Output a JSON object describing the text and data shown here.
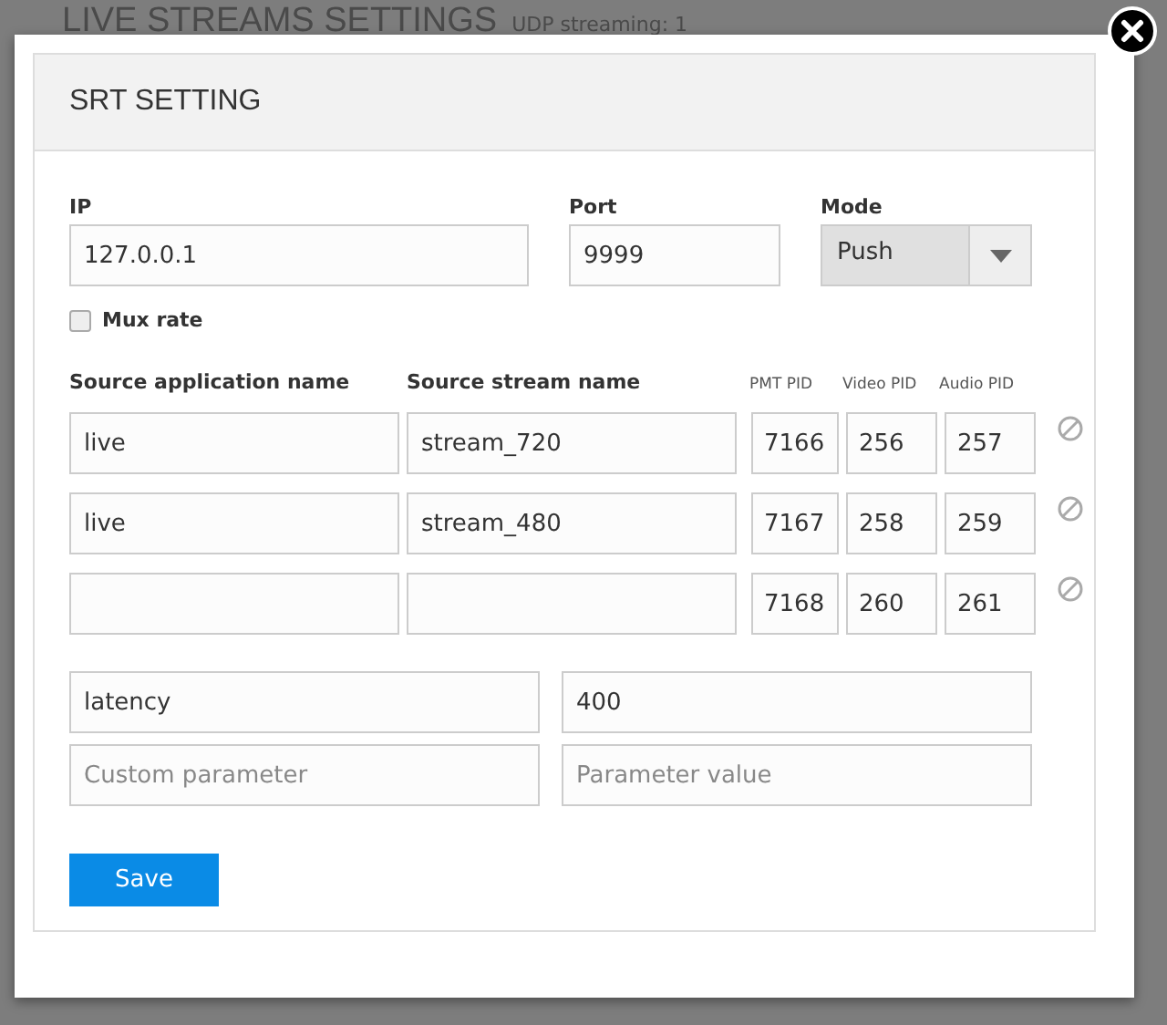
{
  "page": {
    "title": "LIVE STREAMS SETTINGS",
    "subtitle": "UDP streaming: 1"
  },
  "dialog": {
    "title": "SRT SETTING",
    "ip": {
      "label": "IP",
      "value": "127.0.0.1"
    },
    "port": {
      "label": "Port",
      "value": "9999"
    },
    "mode": {
      "label": "Mode",
      "value": "Push"
    },
    "mux_rate": {
      "label": "Mux rate",
      "checked": false
    },
    "streams": {
      "columns": [
        "Source application name",
        "Source stream name",
        "PMT PID",
        "Video PID",
        "Audio PID"
      ],
      "rows": [
        {
          "app": "live",
          "stream": "stream_720",
          "pmt": "7166",
          "video": "256",
          "audio": "257"
        },
        {
          "app": "live",
          "stream": "stream_480",
          "pmt": "7167",
          "video": "258",
          "audio": "259"
        },
        {
          "pmt": "7168",
          "video": "260",
          "audio": "261"
        }
      ]
    },
    "params": [
      {
        "name": {
          "value": "latency"
        },
        "value": {
          "value": "400"
        }
      },
      {
        "name": {
          "placeholder": "Custom parameter"
        },
        "value": {
          "placeholder": "Parameter value"
        }
      }
    ],
    "buttons": [
      "Save"
    ]
  }
}
